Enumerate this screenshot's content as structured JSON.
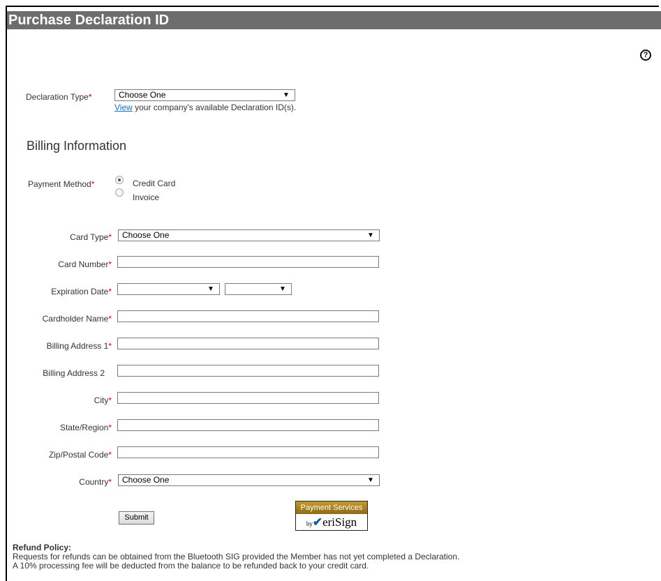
{
  "header": {
    "title": "Purchase Declaration ID"
  },
  "icons": {
    "help": "help-circle-icon",
    "help_glyph": "?"
  },
  "declaration": {
    "label": "Declaration Type",
    "required_mark": "*",
    "select_value": "Choose One",
    "view_link": "View",
    "view_text": " your company's available Declaration ID(s)."
  },
  "billing": {
    "section_title": "Billing Information",
    "payment_method": {
      "label": "Payment Method",
      "options": [
        {
          "label": "Credit Card",
          "selected": true
        },
        {
          "label": "Invoice",
          "selected": false
        }
      ]
    },
    "fields": {
      "card_type": {
        "label": "Card Type",
        "value": "Choose One"
      },
      "card_number": {
        "label": "Card Number",
        "value": ""
      },
      "expiration_date": {
        "label": "Expiration Date",
        "month": "",
        "year": ""
      },
      "cardholder_name": {
        "label": "Cardholder Name",
        "value": ""
      },
      "billing_address_1": {
        "label": "Billing Address 1",
        "value": ""
      },
      "billing_address_2": {
        "label": "Billing Address 2",
        "value": ""
      },
      "city": {
        "label": "City",
        "value": ""
      },
      "state_region": {
        "label": "State/Region",
        "value": ""
      },
      "zip_postal_code": {
        "label": "Zip/Postal Code",
        "value": ""
      },
      "country": {
        "label": "Country",
        "value": "Choose One"
      }
    },
    "required_mark": "*"
  },
  "submit_label": "Submit",
  "verisign_badge": {
    "top_text": "Payment Services",
    "by_text": "by",
    "brand_check": "✔",
    "brand_text": "eriSign",
    "colors": {
      "band": "#b08424",
      "check": "#0a5fa8"
    }
  },
  "refund_policy": {
    "title": "Refund Policy:",
    "lines": [
      "Requests for refunds can be obtained from the Bluetooth SIG provided the Member has not yet completed a Declaration.",
      "A 10% processing fee will be deducted from the balance to be refunded back to your credit card."
    ]
  },
  "colors": {
    "title_bar": "#6d6d6d",
    "required": "#cc0000",
    "link": "#1a6eb5"
  }
}
